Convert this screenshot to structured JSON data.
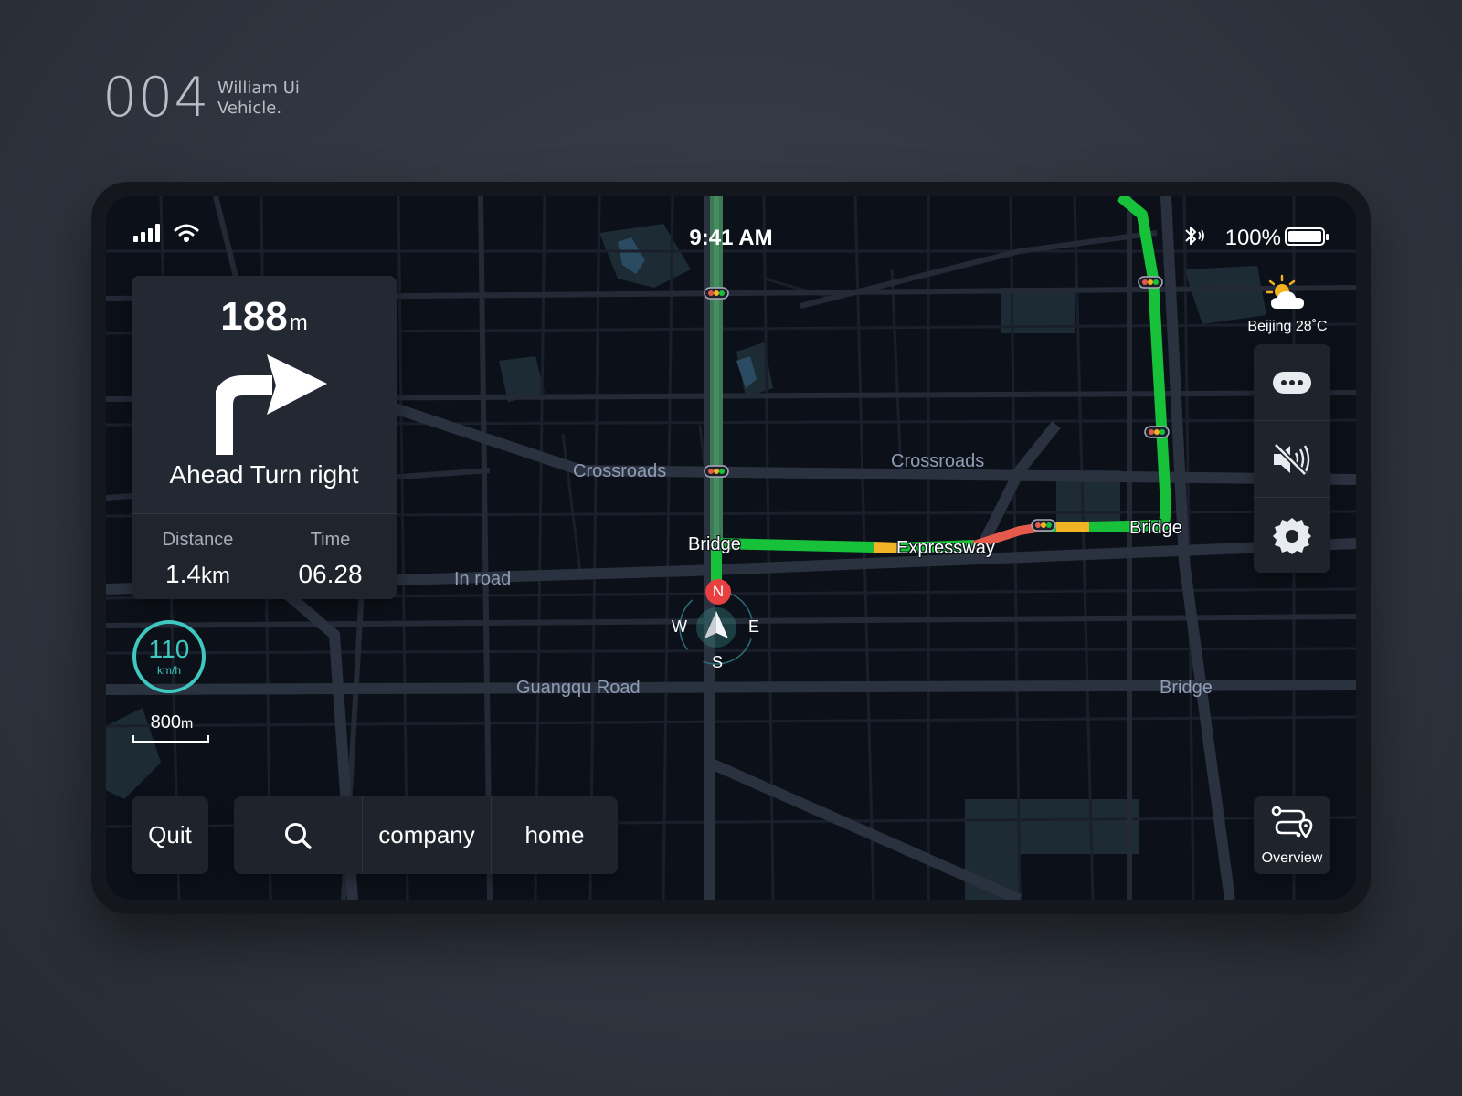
{
  "brand": {
    "number": "004",
    "line1": "William Ui",
    "line2": "Vehicle."
  },
  "status_bar": {
    "time": "9:41 AM",
    "battery_percent": "100%",
    "battery_level": 1.0,
    "signal": "signal-icon",
    "wifi": "wifi-icon",
    "bluetooth": "bluetooth-icon"
  },
  "guidance": {
    "distance_value": "188",
    "distance_unit": "m",
    "instruction": "Ahead Turn right",
    "maneuver_icon": "turn-right-arrow-icon",
    "distance_label": "Distance",
    "distance_total_value": "1.4",
    "distance_total_unit": "km",
    "time_label": "Time",
    "time_value": "06.28"
  },
  "speed": {
    "value": "110",
    "unit": "km/h"
  },
  "scale": {
    "value": "800",
    "unit": "m"
  },
  "weather": {
    "icon": "partly-cloudy-icon",
    "label": "Beijing 28˚C"
  },
  "side_controls": [
    {
      "icon": "more-icon"
    },
    {
      "icon": "mute-icon"
    },
    {
      "icon": "settings-icon"
    }
  ],
  "bottom_bar": {
    "quit_label": "Quit",
    "search_icon": "search-icon",
    "shortcut_1": "company",
    "shortcut_2": "home",
    "overview_label": "Overview",
    "overview_icon": "route-overview-icon"
  },
  "map_labels": {
    "crossroads_1": "Crossroads",
    "crossroads_2": "Crossroads",
    "in_road": "In road",
    "guangqu_road": "Guangqu Road",
    "bridge_muted": "Bridge",
    "bridge_1": "Bridge",
    "bridge_2": "Bridge",
    "expressway": "Expressway"
  },
  "compass": {
    "n": "N",
    "s": "S",
    "e": "E",
    "w": "W"
  },
  "colors": {
    "background": "#30353f",
    "screen": "#0c1119",
    "route_clear": "#17c23a",
    "route_slow": "#f0b424",
    "route_jam": "#e55a4a",
    "speed_ring": "#3fc7c1",
    "compass_north": "#e84040",
    "panel": "#1e232c"
  }
}
